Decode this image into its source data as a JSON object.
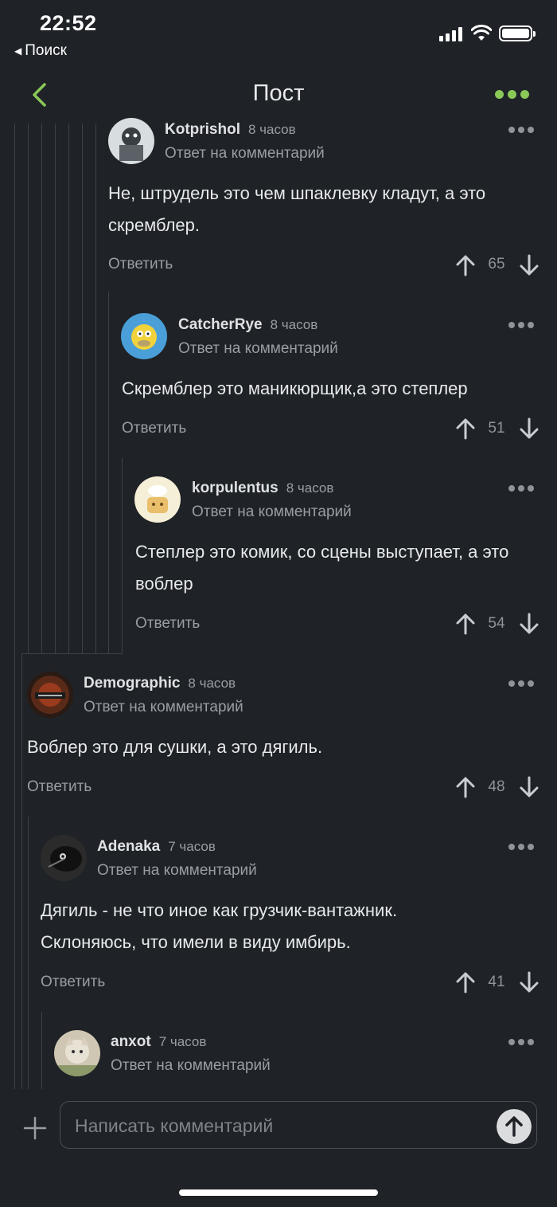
{
  "status_bar": {
    "time": "22:52",
    "back_app": "Поиск"
  },
  "nav": {
    "title": "Пост"
  },
  "comments": [
    {
      "user": "Kotprishol",
      "time": "8 часов",
      "note": "Ответ на комментарий",
      "text": "Не, штрудель это чем шпаклевку кладут, а это скремблер.",
      "reply": "Ответить",
      "score": "65"
    },
    {
      "user": "CatcherRye",
      "time": "8 часов",
      "note": "Ответ на комментарий",
      "text": "Скремблер это маникюрщик,а это степлер",
      "reply": "Ответить",
      "score": "51"
    },
    {
      "user": "korpulentus",
      "time": "8 часов",
      "note": "Ответ на комментарий",
      "text": "Степлер это комик, со сцены выступает, а это воблер",
      "reply": "Ответить",
      "score": "54"
    },
    {
      "user": "Demographic",
      "time": "8 часов",
      "note": "Ответ на комментарий",
      "text": "Воблер это для сушки, а это дягиль.",
      "reply": "Ответить",
      "score": "48"
    },
    {
      "user": "Adenaka",
      "time": "7 часов",
      "note": "Ответ на комментарий",
      "text": "Дягиль - не что иное как грузчик-вантажник. Склоняюсь, что имели в виду имбирь.",
      "reply": "Ответить",
      "score": "41"
    },
    {
      "user": "anxot",
      "time": "7 часов",
      "note": "Ответ на комментарий"
    }
  ],
  "composer": {
    "placeholder": "Написать комментарий"
  },
  "colors": {
    "accent": "#8ac858",
    "background": "#1f2226",
    "muted": "#9a9ea3"
  },
  "icons": [
    "chevron-left-icon",
    "more-dots-icon",
    "upvote-arrow-icon",
    "downvote-arrow-icon",
    "plus-icon",
    "send-arrow-icon"
  ]
}
